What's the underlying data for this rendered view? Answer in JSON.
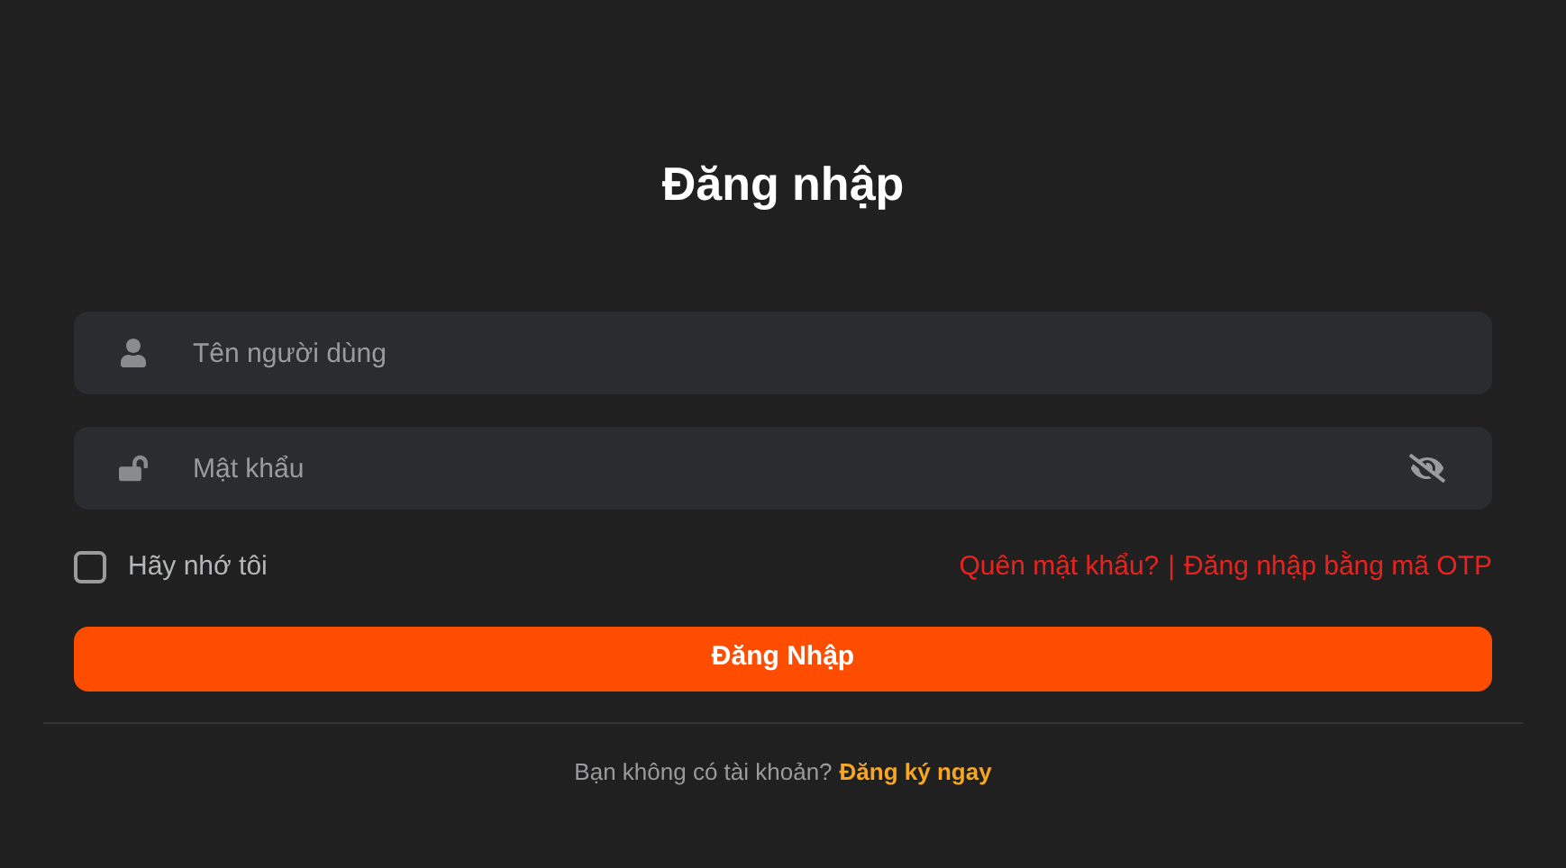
{
  "title": "Đăng nhập",
  "username": {
    "placeholder": "Tên người dùng"
  },
  "password": {
    "placeholder": "Mật khẩu",
    "visible": false
  },
  "remember": {
    "label": "Hãy nhớ tôi",
    "checked": false
  },
  "links": {
    "forgot": "Quên mật khẩu?",
    "separator": "|",
    "otp": "Đăng nhập bằng mã OTP"
  },
  "submit": "Đăng Nhập",
  "footer": {
    "text": "Bạn không có tài khoản?",
    "link": "Đăng ký ngay"
  }
}
